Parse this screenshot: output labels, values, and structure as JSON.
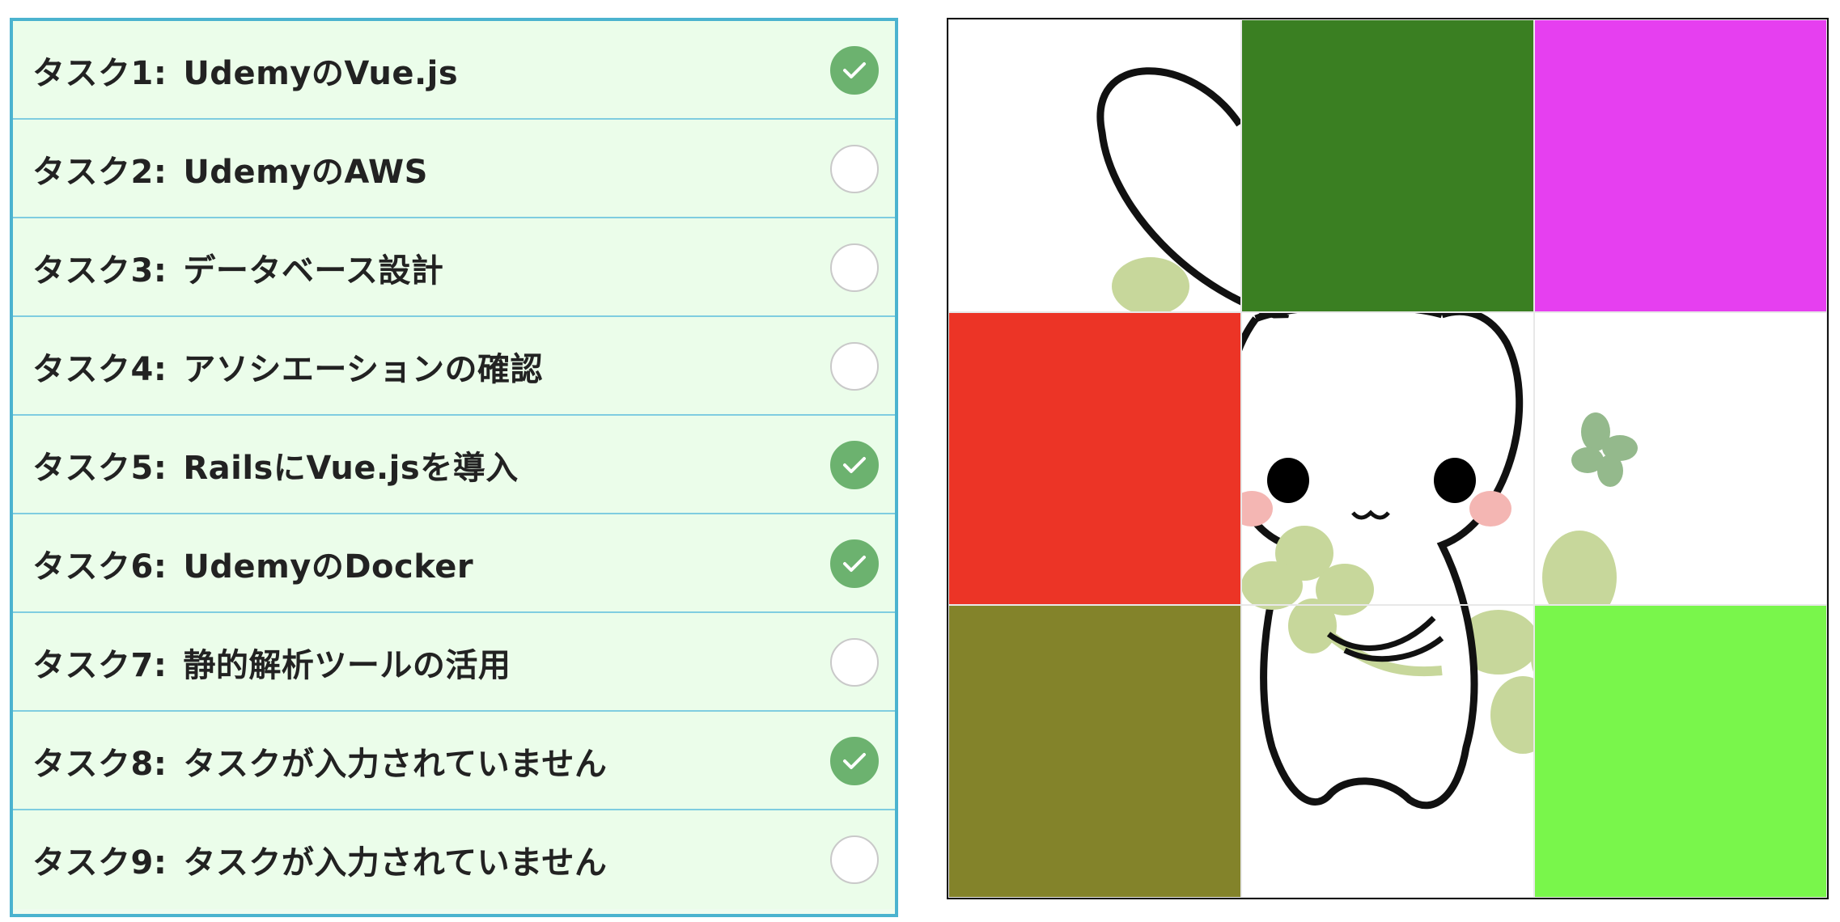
{
  "tasks": [
    {
      "num": "タスク1:",
      "text": "UdemyのVue.js",
      "done": true
    },
    {
      "num": "タスク2:",
      "text": "UdemyのAWS",
      "done": false
    },
    {
      "num": "タスク3:",
      "text": "データベース設計",
      "done": false
    },
    {
      "num": "タスク4:",
      "text": "アソシエーションの確認",
      "done": false
    },
    {
      "num": "タスク5:",
      "text": "RailsにVue.jsを導入",
      "done": true
    },
    {
      "num": "タスク6:",
      "text": "UdemyのDocker",
      "done": true
    },
    {
      "num": "タスク7:",
      "text": "静的解析ツールの活用",
      "done": false
    },
    {
      "num": "タスク8:",
      "text": "タスクが入力されていません",
      "done": true
    },
    {
      "num": "タスク9:",
      "text": "タスクが入力されていません",
      "done": false
    }
  ],
  "puzzle": {
    "tiles": [
      {
        "slot": 1,
        "content": "image",
        "color": ""
      },
      {
        "slot": 2,
        "content": "color",
        "color": "#3a7f22"
      },
      {
        "slot": 3,
        "content": "color",
        "color": "#e63ff0"
      },
      {
        "slot": 4,
        "content": "color",
        "color": "#ec3426"
      },
      {
        "slot": 5,
        "content": "image",
        "color": ""
      },
      {
        "slot": 6,
        "content": "image",
        "color": ""
      },
      {
        "slot": 7,
        "content": "color",
        "color": "#83832a"
      },
      {
        "slot": 8,
        "content": "image",
        "color": ""
      },
      {
        "slot": 9,
        "content": "color",
        "color": "#79f64b"
      }
    ],
    "image_subject": "rabbit-holding-clover",
    "colors": {
      "checked": "#6cb26f",
      "panel_border": "#4bb3cf",
      "row_background": "#ebfdea"
    }
  }
}
